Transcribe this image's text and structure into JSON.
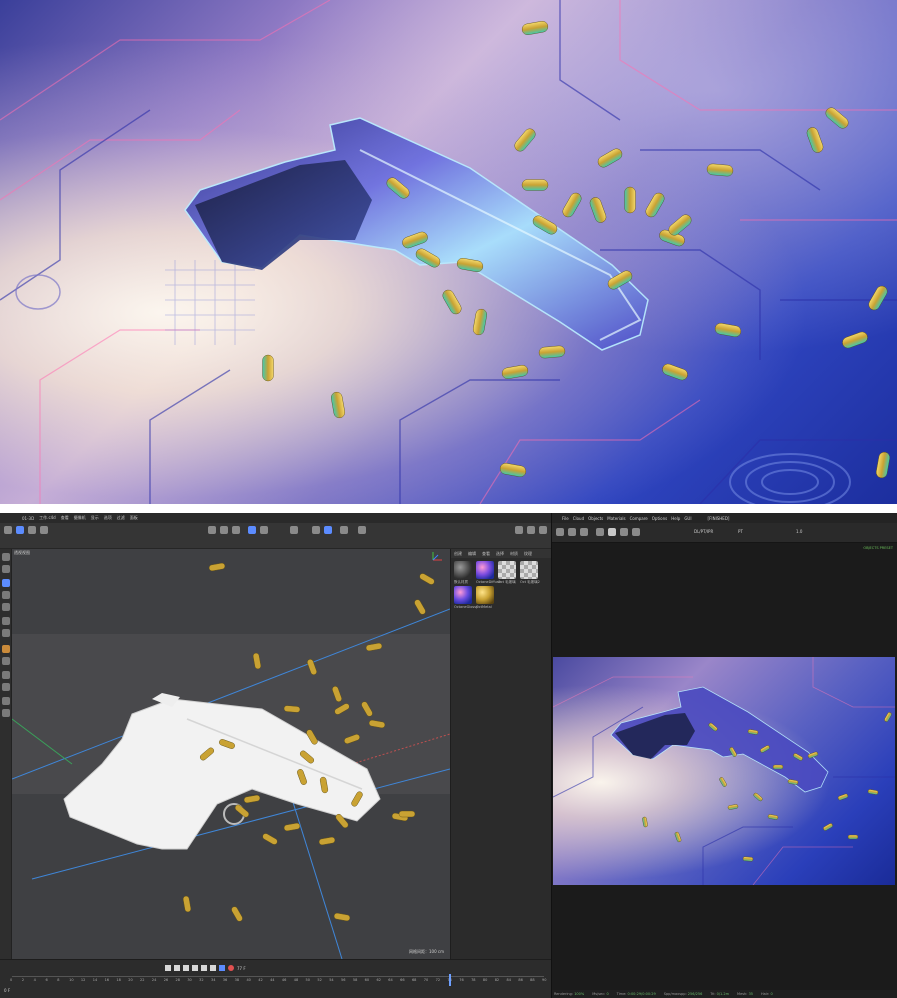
{
  "c4d_window": {
    "title": "01-3D",
    "tab": "工作.c4d",
    "menus": [
      "查看",
      "摄像机",
      "显示",
      "选项",
      "过滤",
      "面板"
    ],
    "viewport_label": "透视视图",
    "viewport_scale": "网格间距：100 cm",
    "material_tabs": [
      "创建",
      "编辑",
      "查看",
      "选择",
      "材质",
      "纹理"
    ],
    "materials": [
      {
        "label": "默认材质"
      },
      {
        "label": "OctaneDiffuse"
      },
      {
        "label": "Oct 毛玻璃"
      },
      {
        "label": "Oct 毛玻璃2"
      },
      {
        "label": "OctaneGlossy"
      },
      {
        "label": "OctMetal"
      }
    ],
    "timeline": {
      "ticks": [
        "0",
        "2",
        "4",
        "6",
        "8",
        "10",
        "12",
        "14",
        "16",
        "18",
        "20",
        "22",
        "24",
        "26",
        "28",
        "30",
        "32",
        "34",
        "36",
        "38",
        "40",
        "42",
        "44",
        "46",
        "48",
        "50",
        "52",
        "54",
        "56",
        "58",
        "60",
        "62",
        "64",
        "66",
        "68",
        "70",
        "72",
        "74",
        "76",
        "78",
        "80",
        "82",
        "84",
        "86",
        "88",
        "90"
      ],
      "current_frame": "0 F",
      "end_frame": "77 F",
      "cursor_frame": 74
    }
  },
  "render_view": {
    "menus": [
      "File",
      "Cloud",
      "Objects",
      "Materials",
      "Compare",
      "Options",
      "Help",
      "GUI"
    ],
    "title": "[FINISHED]",
    "toolbar": {
      "mode": "DL/PT/IPR",
      "kernel": "PT",
      "samples": "1.0"
    },
    "corner_label": "OBJECTS  PRESET",
    "status": [
      {
        "label": "Rendering:",
        "value": "100%"
      },
      {
        "label": "Ms/sec:",
        "value": "0"
      },
      {
        "label": "Time:",
        "value": "0:00:29/0:00:29"
      },
      {
        "label": "Spp/maxspp:",
        "value": "256/256"
      },
      {
        "label": "Tri:",
        "value": "0/1.2m"
      },
      {
        "label": "Mesh:",
        "value": "35"
      },
      {
        "label": "Hair:",
        "value": "0"
      }
    ]
  },
  "colors": {
    "accent": "#4a7cff",
    "brass": "#c9a233",
    "panel": "#313131"
  }
}
